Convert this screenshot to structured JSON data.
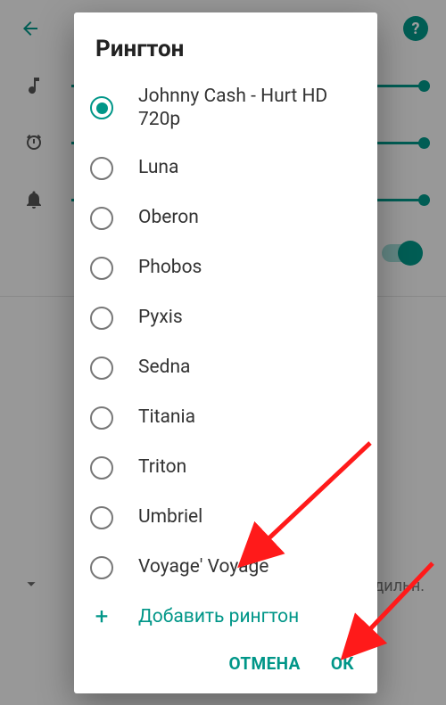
{
  "dialog": {
    "title": "Рингтон",
    "add_label": "Добавить рингтон",
    "cancel": "ОТМЕНА",
    "ok": "ОК",
    "items": [
      {
        "label": "Johnny Cash - Hurt HD 720p",
        "selected": true
      },
      {
        "label": "Luna",
        "selected": false
      },
      {
        "label": "Oberon",
        "selected": false
      },
      {
        "label": "Phobos",
        "selected": false
      },
      {
        "label": "Pyxis",
        "selected": false
      },
      {
        "label": "Sedna",
        "selected": false
      },
      {
        "label": "Titania",
        "selected": false
      },
      {
        "label": "Triton",
        "selected": false
      },
      {
        "label": "Umbriel",
        "selected": false
      },
      {
        "label": "Voyage' Voyage",
        "selected": false
      }
    ]
  },
  "background": {
    "truncated_text": "дильн."
  }
}
